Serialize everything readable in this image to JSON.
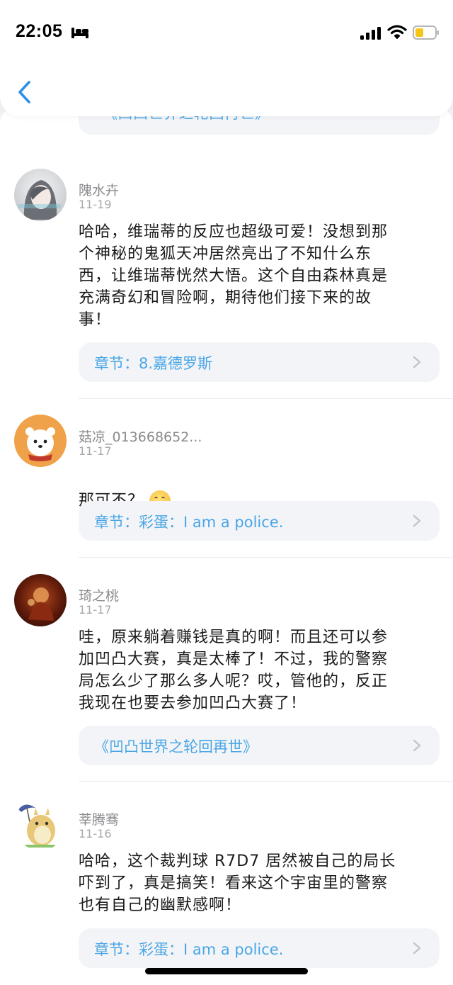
{
  "status_bar": {
    "time": "22:05"
  },
  "top_chip": {
    "label": "《凹凸世界之轮回再世》"
  },
  "comments": [
    {
      "username": "隗水卉",
      "date": "11-19",
      "text": "哈哈，维瑞蒂的反应也超级可爱！没想到那\n个神秘的鬼狐天冲居然亮出了不知什么东\n西，让维瑞蒂恍然大悟。这个自由森林真是\n充满奇幻和冒险啊，期待他们接下来的故\n事！",
      "chip": "章节：8.嘉德罗斯"
    },
    {
      "username": "菇凉_013668652...",
      "date": "11-17",
      "text": "那可不？",
      "chip": "章节：彩蛋：I am a police."
    },
    {
      "username": "琦之桃",
      "date": "11-17",
      "text": "哇，原来躺着赚钱是真的啊！而且还可以参\n加凹凸大赛，真是太棒了！不过，我的警察\n局怎么少了那么多人呢？哎，管他的，反正\n我现在也要去参加凹凸大赛了！",
      "chip": "《凹凸世界之轮回再世》"
    },
    {
      "username": "莘腾骞",
      "date": "11-16",
      "text": "哈哈，这个裁判球 R7D7 居然被自己的局长\n吓到了，真是搞笑！看来这个宇宙里的警察\n也有自己的幽默感啊！",
      "chip": "章节：彩蛋：I am a police."
    }
  ],
  "colors": {
    "accent": "#4aa6e6",
    "chip_bg": "#f3f4f7",
    "back": "#2f8fe6",
    "battery": "#f5c518"
  },
  "icons": [
    "sleep-icon",
    "signal-icon",
    "wifi-icon",
    "battery-icon",
    "back-chevron-icon",
    "chevron-right-icon",
    "hand-over-mouth-emoji-icon"
  ]
}
